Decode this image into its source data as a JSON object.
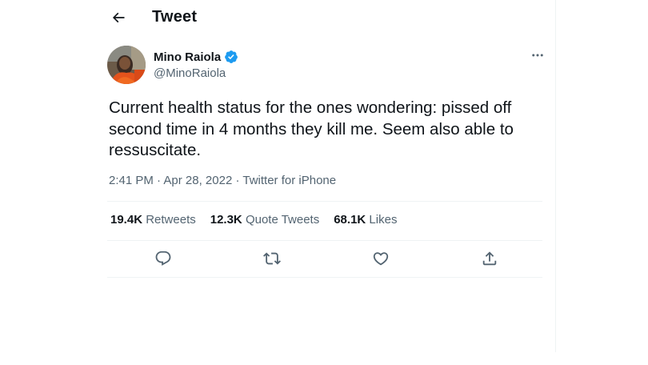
{
  "header": {
    "title": "Tweet",
    "back_icon": "arrow-left-icon"
  },
  "author": {
    "name": "Mino Raiola",
    "handle": "@MinoRaiola",
    "verified_icon": "verified-badge-icon",
    "more_icon": "more-horizontal-icon"
  },
  "tweet": {
    "text": "Current health status for the ones wondering: pissed off second time in 4 months they kill me. Seem also able to ressuscitate.",
    "time": "2:41 PM",
    "separator": "·",
    "date": "Apr 28, 2022",
    "source": "Twitter for iPhone"
  },
  "stats": {
    "retweets_count": "19.4K",
    "retweets_label": "Retweets",
    "quotes_count": "12.3K",
    "quotes_label": "Quote Tweets",
    "likes_count": "68.1K",
    "likes_label": "Likes"
  },
  "actions": {
    "reply_icon": "reply-icon",
    "retweet_icon": "retweet-icon",
    "like_icon": "heart-icon",
    "share_icon": "share-icon"
  },
  "colors": {
    "text_primary": "#0f1419",
    "text_secondary": "#536471",
    "verified_blue": "#1d9bf0",
    "divider": "#eff3f4"
  }
}
